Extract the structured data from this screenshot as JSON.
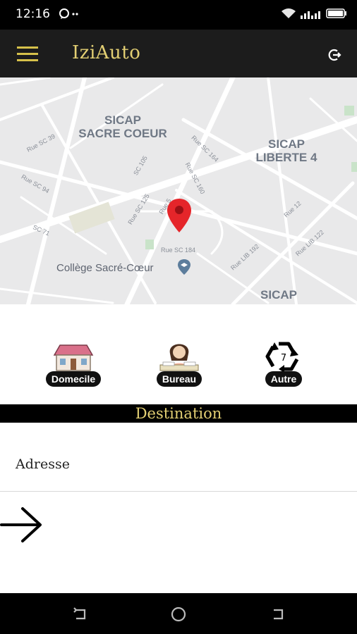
{
  "status_bar": {
    "time": "12:16",
    "icons": [
      "chat-bubble-icon",
      "dots-icon",
      "wifi-icon",
      "signal-icon",
      "battery-icon"
    ]
  },
  "app_bar": {
    "title": "IziAuto",
    "menu_icon": "hamburger-menu-icon",
    "action_icon": "logout-icon",
    "accent_color": "#e3cf73",
    "background": "#1c1c1c"
  },
  "map": {
    "labels": [
      {
        "id": "sicap-sacre-coeur",
        "text": "SICAP\nSACRE COEUR"
      },
      {
        "id": "sicap-liberte-4",
        "text": "SICAP\nLIBERTE 4"
      },
      {
        "id": "sicap",
        "text": "SICAP"
      },
      {
        "id": "college",
        "text": "Collège Sacré-Cœur"
      }
    ],
    "streets": [
      "Rue SC 39",
      "Rue SC 94",
      "SC 71",
      "SC 105",
      "Rue SC 164",
      "Rue SC 160",
      "Rue SC 125",
      "Rue 5",
      "Rue SC 184",
      "Rue 12",
      "Rue LIB 192",
      "Rue LIB 122"
    ],
    "marker_color": "#e5252a"
  },
  "places": {
    "home_label": "Domecile",
    "office_label": "Bureau",
    "other_label": "Autre"
  },
  "destination": {
    "header": "Destination",
    "address_label": "Adresse"
  },
  "nav_bar": {
    "icons": [
      "recent-apps-icon",
      "home-icon",
      "back-icon"
    ]
  }
}
